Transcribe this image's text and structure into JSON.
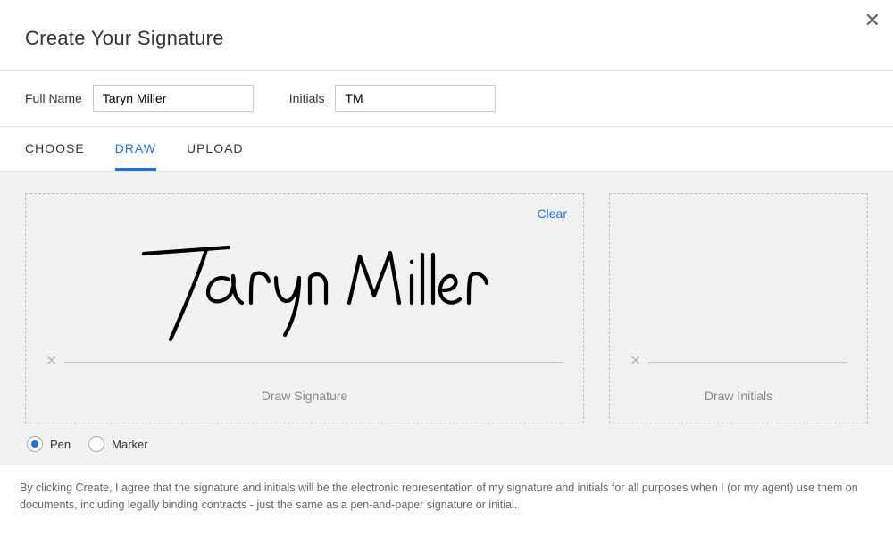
{
  "modal": {
    "title": "Create Your Signature",
    "close_icon": "✕"
  },
  "fields": {
    "fullname_label": "Full Name",
    "fullname_value": "Taryn Miller",
    "initials_label": "Initials",
    "initials_value": "TM"
  },
  "tabs": {
    "choose": "CHOOSE",
    "draw": "DRAW",
    "upload": "UPLOAD",
    "active": "draw"
  },
  "signature": {
    "clear_label": "Clear",
    "caption": "Draw Signature",
    "delete_icon": "✕",
    "drawn_name": "Taryn Miller"
  },
  "initials": {
    "caption": "Draw Initials",
    "delete_icon": "✕"
  },
  "tools": {
    "pen_label": "Pen",
    "marker_label": "Marker",
    "selected": "pen"
  },
  "disclosure": "By clicking Create, I agree that the signature and initials will be the electronic representation of my signature and initials for all purposes when I (or my agent) use them on documents, including legally binding contracts - just the same as a pen-and-paper signature or initial."
}
